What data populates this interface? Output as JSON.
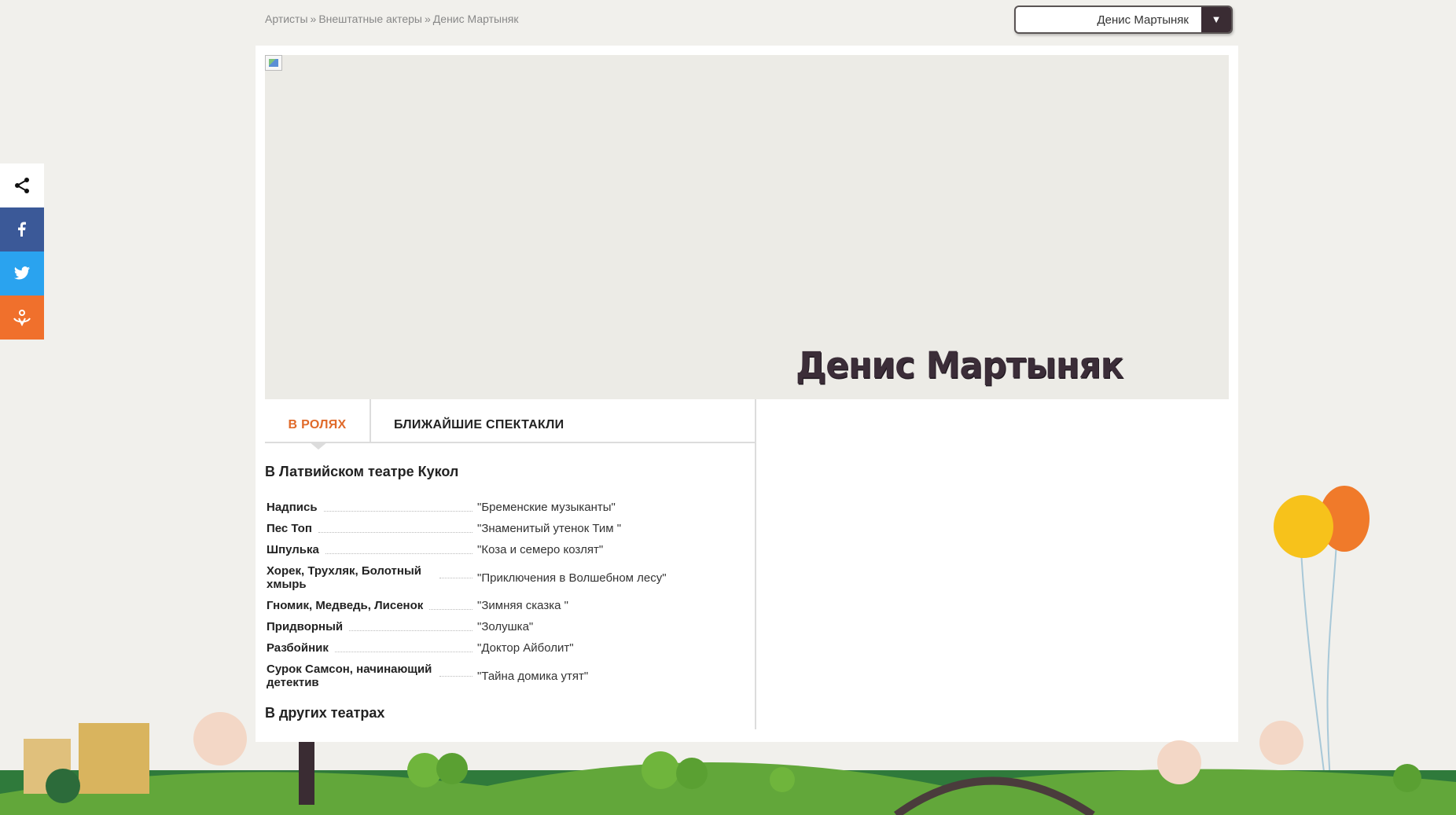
{
  "breadcrumb": {
    "items": [
      "Артисты",
      "Внештатные актеры",
      "Денис Мартыняк"
    ],
    "separator": "»"
  },
  "artist_select": {
    "selected": "Денис Мартыняк",
    "arrow_icon": "chevron-down-icon"
  },
  "share": {
    "buttons": [
      {
        "name": "share",
        "icon": "share-icon",
        "color": "#ffffff"
      },
      {
        "name": "facebook",
        "icon": "facebook-icon",
        "color": "#3b5998"
      },
      {
        "name": "twitter",
        "icon": "twitter-icon",
        "color": "#2aa3ef"
      },
      {
        "name": "odnoklassniki",
        "icon": "odnoklassniki-icon",
        "color": "#f0702c"
      }
    ]
  },
  "banner": {
    "artist_name": "Денис Мартыняк"
  },
  "tabs": {
    "active": "В РОЛЯХ",
    "inactive": "БЛИЖАЙШИЕ СПЕКТАКЛИ",
    "active_color": "#e06a2a"
  },
  "section_title": "В Латвийском театре Кукол",
  "roles": [
    {
      "role": "Надпись",
      "show": "\"Бременские музыканты\""
    },
    {
      "role": "Пес Топ",
      "show": "\"Знаменитый утенок Тим \""
    },
    {
      "role": "Шпулька",
      "show": "\"Коза и семеро козлят\""
    },
    {
      "role": "Хорек, Трухляк, Болотный хмырь",
      "show": "\"Приключения в Волшебном лесу\""
    },
    {
      "role": "Гномик, Медведь, Лисенок",
      "show": "\"Зимняя сказка \""
    },
    {
      "role": "Придворный",
      "show": "\"Золушка\""
    },
    {
      "role": "Разбойник",
      "show": "\"Доктор Айболит\""
    },
    {
      "role": "Сурок Самсон, начинающий детектив",
      "show": "\"Тайна домика утят\""
    }
  ],
  "other_title": "В других театрах"
}
